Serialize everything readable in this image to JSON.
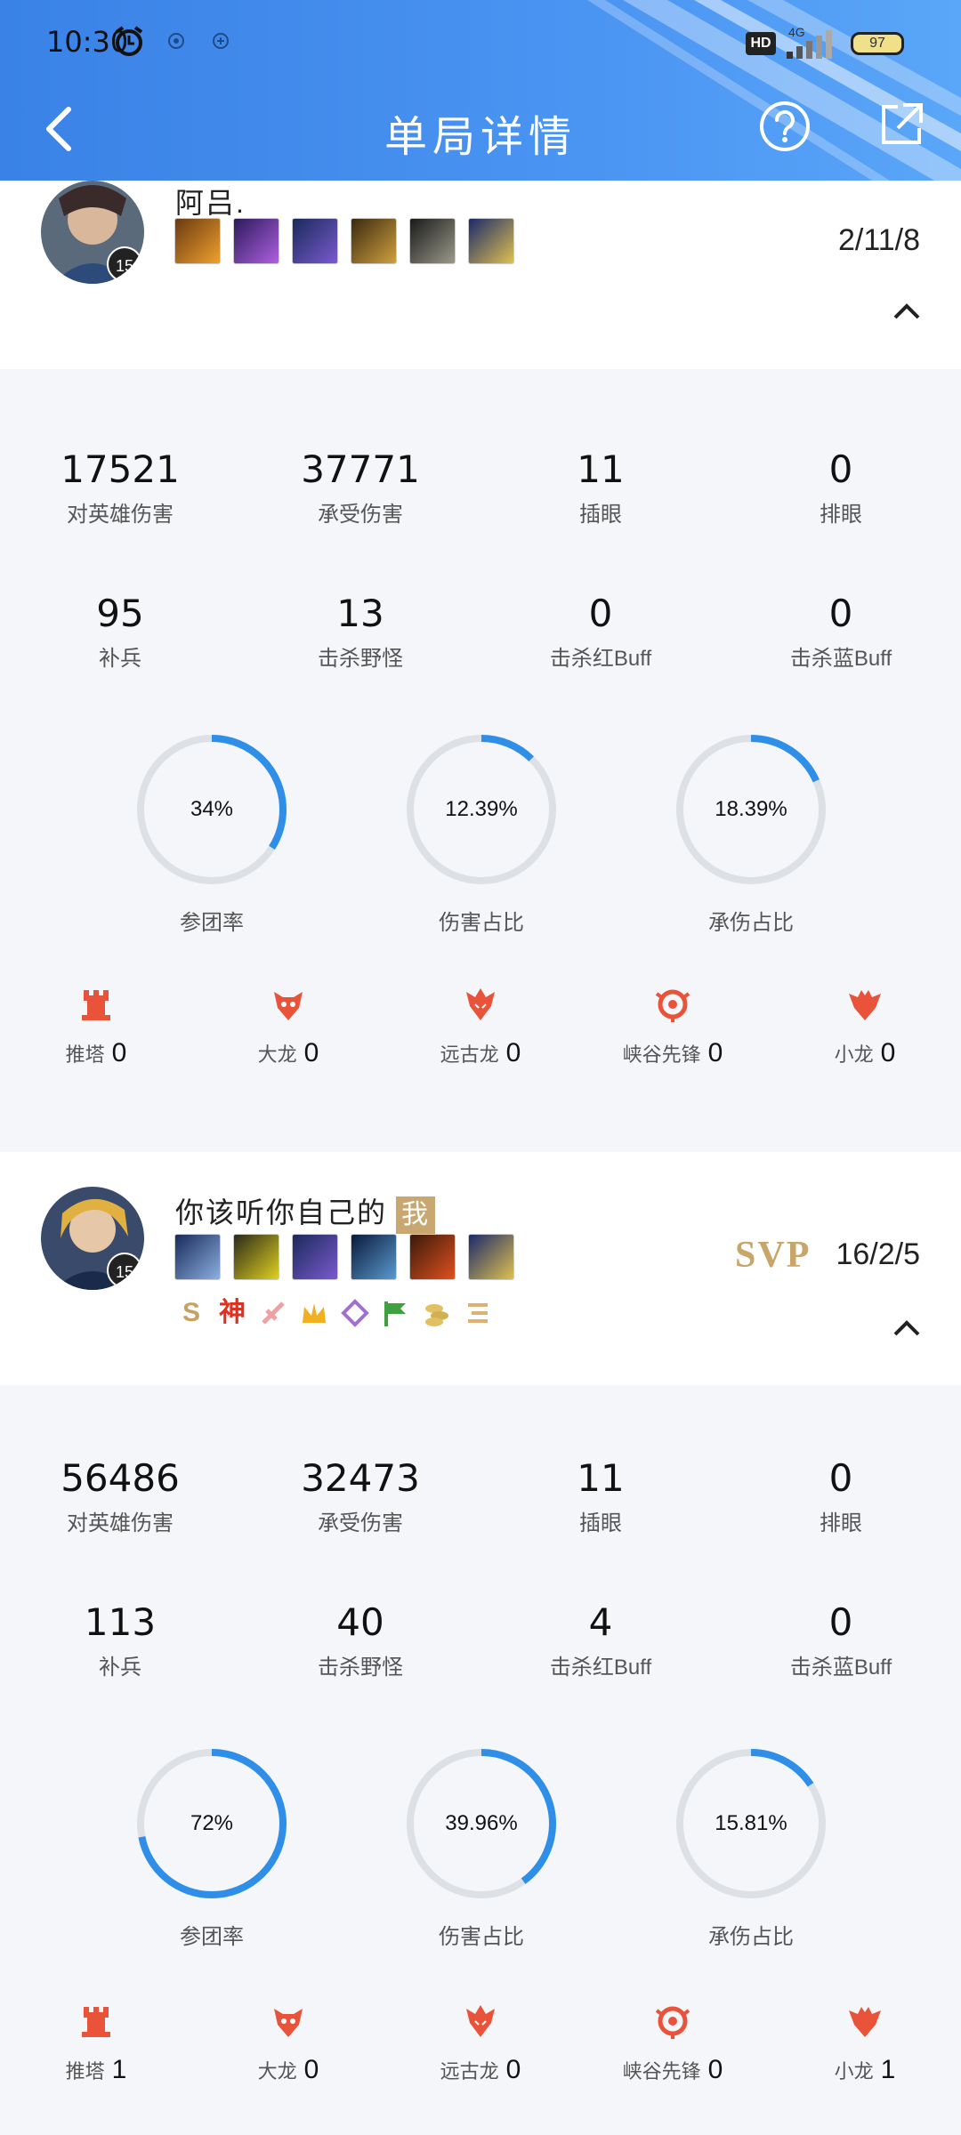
{
  "status_bar": {
    "time": "10:30",
    "network": "4G",
    "hd": "HD",
    "battery": "97"
  },
  "nav": {
    "title": "单局详情",
    "back_icon": "chevron-left-icon",
    "help_icon": "help-circle-icon",
    "share_icon": "share-icon"
  },
  "colors": {
    "header": "#3f88ec",
    "ring_fill": "#2f8fe8",
    "ring_track": "#dde1e6",
    "objective": "#e8533a",
    "svp": "#c8a568"
  },
  "players": [
    {
      "name": "阿吕.",
      "level": "15",
      "kda": "2/11/8",
      "svp": "",
      "me_badge": "",
      "items": [
        "item-1",
        "item-2",
        "item-3",
        "item-4",
        "item-5",
        "item-6"
      ],
      "stats": [
        {
          "value": "17521",
          "label": "对英雄伤害"
        },
        {
          "value": "37771",
          "label": "承受伤害"
        },
        {
          "value": "11",
          "label": "插眼"
        },
        {
          "value": "0",
          "label": "排眼"
        },
        {
          "value": "95",
          "label": "补兵"
        },
        {
          "value": "13",
          "label": "击杀野怪"
        },
        {
          "value": "0",
          "label": "击杀红Buff"
        },
        {
          "value": "0",
          "label": "击杀蓝Buff"
        }
      ],
      "rings": [
        {
          "pct_text": "34%",
          "value": 0.34,
          "label": "参团率"
        },
        {
          "pct_text": "12.39%",
          "value": 0.1239,
          "label": "伤害占比"
        },
        {
          "pct_text": "18.39%",
          "value": 0.1839,
          "label": "承伤占比"
        }
      ],
      "objectives": [
        {
          "label": "推塔",
          "count": "0",
          "icon": "tower-icon"
        },
        {
          "label": "大龙",
          "count": "0",
          "icon": "baron-icon"
        },
        {
          "label": "远古龙",
          "count": "0",
          "icon": "elder-dragon-icon"
        },
        {
          "label": "峡谷先锋",
          "count": "0",
          "icon": "herald-icon"
        },
        {
          "label": "小龙",
          "count": "0",
          "icon": "dragon-icon"
        }
      ]
    },
    {
      "name": "你该听你自己的",
      "level": "15",
      "kda": "16/2/5",
      "svp": "SVP",
      "me_badge": "我",
      "items": [
        "item-1",
        "item-2",
        "item-3",
        "item-4",
        "item-5",
        "item-6"
      ],
      "honors": [
        "S",
        "神"
      ],
      "stats": [
        {
          "value": "56486",
          "label": "对英雄伤害"
        },
        {
          "value": "32473",
          "label": "承受伤害"
        },
        {
          "value": "11",
          "label": "插眼"
        },
        {
          "value": "0",
          "label": "排眼"
        },
        {
          "value": "113",
          "label": "补兵"
        },
        {
          "value": "40",
          "label": "击杀野怪"
        },
        {
          "value": "4",
          "label": "击杀红Buff"
        },
        {
          "value": "0",
          "label": "击杀蓝Buff"
        }
      ],
      "rings": [
        {
          "pct_text": "72%",
          "value": 0.72,
          "label": "参团率"
        },
        {
          "pct_text": "39.96%",
          "value": 0.3996,
          "label": "伤害占比"
        },
        {
          "pct_text": "15.81%",
          "value": 0.1581,
          "label": "承伤占比"
        }
      ],
      "objectives": [
        {
          "label": "推塔",
          "count": "1",
          "icon": "tower-icon"
        },
        {
          "label": "大龙",
          "count": "0",
          "icon": "baron-icon"
        },
        {
          "label": "远古龙",
          "count": "0",
          "icon": "elder-dragon-icon"
        },
        {
          "label": "峡谷先锋",
          "count": "0",
          "icon": "herald-icon"
        },
        {
          "label": "小龙",
          "count": "1",
          "icon": "dragon-icon"
        }
      ]
    }
  ]
}
